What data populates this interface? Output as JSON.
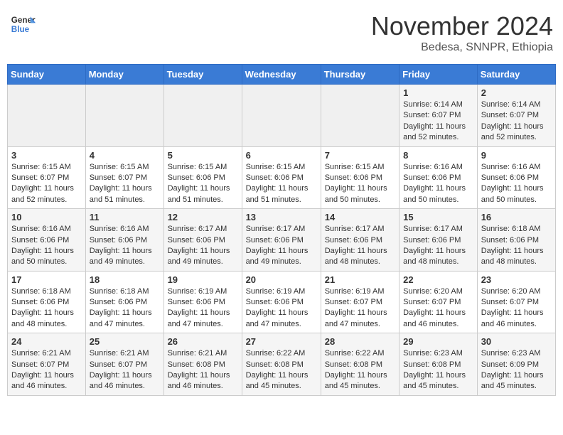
{
  "header": {
    "logo_line1": "General",
    "logo_line2": "Blue",
    "month_year": "November 2024",
    "location": "Bedesa, SNNPR, Ethiopia"
  },
  "weekdays": [
    "Sunday",
    "Monday",
    "Tuesday",
    "Wednesday",
    "Thursday",
    "Friday",
    "Saturday"
  ],
  "weeks": [
    [
      {
        "day": "",
        "info": ""
      },
      {
        "day": "",
        "info": ""
      },
      {
        "day": "",
        "info": ""
      },
      {
        "day": "",
        "info": ""
      },
      {
        "day": "",
        "info": ""
      },
      {
        "day": "1",
        "info": "Sunrise: 6:14 AM\nSunset: 6:07 PM\nDaylight: 11 hours and 52 minutes."
      },
      {
        "day": "2",
        "info": "Sunrise: 6:14 AM\nSunset: 6:07 PM\nDaylight: 11 hours and 52 minutes."
      }
    ],
    [
      {
        "day": "3",
        "info": "Sunrise: 6:15 AM\nSunset: 6:07 PM\nDaylight: 11 hours and 52 minutes."
      },
      {
        "day": "4",
        "info": "Sunrise: 6:15 AM\nSunset: 6:07 PM\nDaylight: 11 hours and 51 minutes."
      },
      {
        "day": "5",
        "info": "Sunrise: 6:15 AM\nSunset: 6:06 PM\nDaylight: 11 hours and 51 minutes."
      },
      {
        "day": "6",
        "info": "Sunrise: 6:15 AM\nSunset: 6:06 PM\nDaylight: 11 hours and 51 minutes."
      },
      {
        "day": "7",
        "info": "Sunrise: 6:15 AM\nSunset: 6:06 PM\nDaylight: 11 hours and 50 minutes."
      },
      {
        "day": "8",
        "info": "Sunrise: 6:16 AM\nSunset: 6:06 PM\nDaylight: 11 hours and 50 minutes."
      },
      {
        "day": "9",
        "info": "Sunrise: 6:16 AM\nSunset: 6:06 PM\nDaylight: 11 hours and 50 minutes."
      }
    ],
    [
      {
        "day": "10",
        "info": "Sunrise: 6:16 AM\nSunset: 6:06 PM\nDaylight: 11 hours and 50 minutes."
      },
      {
        "day": "11",
        "info": "Sunrise: 6:16 AM\nSunset: 6:06 PM\nDaylight: 11 hours and 49 minutes."
      },
      {
        "day": "12",
        "info": "Sunrise: 6:17 AM\nSunset: 6:06 PM\nDaylight: 11 hours and 49 minutes."
      },
      {
        "day": "13",
        "info": "Sunrise: 6:17 AM\nSunset: 6:06 PM\nDaylight: 11 hours and 49 minutes."
      },
      {
        "day": "14",
        "info": "Sunrise: 6:17 AM\nSunset: 6:06 PM\nDaylight: 11 hours and 48 minutes."
      },
      {
        "day": "15",
        "info": "Sunrise: 6:17 AM\nSunset: 6:06 PM\nDaylight: 11 hours and 48 minutes."
      },
      {
        "day": "16",
        "info": "Sunrise: 6:18 AM\nSunset: 6:06 PM\nDaylight: 11 hours and 48 minutes."
      }
    ],
    [
      {
        "day": "17",
        "info": "Sunrise: 6:18 AM\nSunset: 6:06 PM\nDaylight: 11 hours and 48 minutes."
      },
      {
        "day": "18",
        "info": "Sunrise: 6:18 AM\nSunset: 6:06 PM\nDaylight: 11 hours and 47 minutes."
      },
      {
        "day": "19",
        "info": "Sunrise: 6:19 AM\nSunset: 6:06 PM\nDaylight: 11 hours and 47 minutes."
      },
      {
        "day": "20",
        "info": "Sunrise: 6:19 AM\nSunset: 6:06 PM\nDaylight: 11 hours and 47 minutes."
      },
      {
        "day": "21",
        "info": "Sunrise: 6:19 AM\nSunset: 6:07 PM\nDaylight: 11 hours and 47 minutes."
      },
      {
        "day": "22",
        "info": "Sunrise: 6:20 AM\nSunset: 6:07 PM\nDaylight: 11 hours and 46 minutes."
      },
      {
        "day": "23",
        "info": "Sunrise: 6:20 AM\nSunset: 6:07 PM\nDaylight: 11 hours and 46 minutes."
      }
    ],
    [
      {
        "day": "24",
        "info": "Sunrise: 6:21 AM\nSunset: 6:07 PM\nDaylight: 11 hours and 46 minutes."
      },
      {
        "day": "25",
        "info": "Sunrise: 6:21 AM\nSunset: 6:07 PM\nDaylight: 11 hours and 46 minutes."
      },
      {
        "day": "26",
        "info": "Sunrise: 6:21 AM\nSunset: 6:08 PM\nDaylight: 11 hours and 46 minutes."
      },
      {
        "day": "27",
        "info": "Sunrise: 6:22 AM\nSunset: 6:08 PM\nDaylight: 11 hours and 45 minutes."
      },
      {
        "day": "28",
        "info": "Sunrise: 6:22 AM\nSunset: 6:08 PM\nDaylight: 11 hours and 45 minutes."
      },
      {
        "day": "29",
        "info": "Sunrise: 6:23 AM\nSunset: 6:08 PM\nDaylight: 11 hours and 45 minutes."
      },
      {
        "day": "30",
        "info": "Sunrise: 6:23 AM\nSunset: 6:09 PM\nDaylight: 11 hours and 45 minutes."
      }
    ]
  ]
}
